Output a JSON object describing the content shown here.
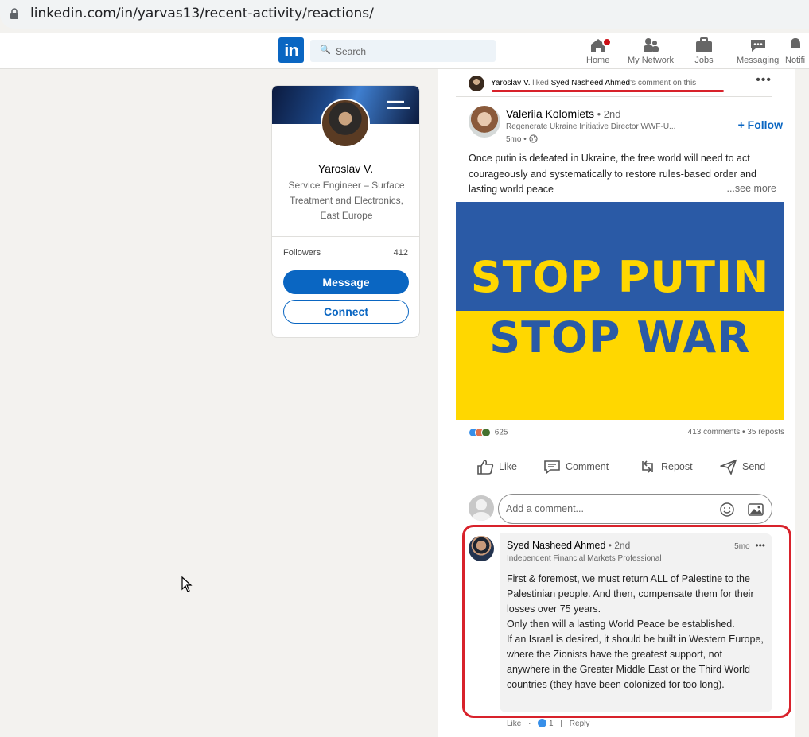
{
  "browser": {
    "url": "linkedin.com/in/yarvas13/recent-activity/reactions/"
  },
  "nav": {
    "logo": "in",
    "search_placeholder": "Search",
    "items": [
      {
        "label": "Home",
        "icon": "home-icon"
      },
      {
        "label": "My Network",
        "icon": "network-icon"
      },
      {
        "label": "Jobs",
        "icon": "briefcase-icon"
      },
      {
        "label": "Messaging",
        "icon": "messaging-icon"
      },
      {
        "label": "Notifi",
        "icon": "bell-icon"
      }
    ]
  },
  "profile": {
    "name": "Yaroslav V.",
    "title": "Service Engineer – Surface Treatment and Electronics, East Europe",
    "followers_label": "Followers",
    "followers_count": "412",
    "message_label": "Message",
    "connect_label": "Connect"
  },
  "activity": {
    "actor": "Yaroslav V.",
    "verb": " liked ",
    "target": "Syed Nasheed Ahmed",
    "suffix": "'s comment on this"
  },
  "post": {
    "author": "Valeriia Kolomiets",
    "degree": " • 2nd",
    "headline": "Regenerate Ukraine Initiative Director WWF-U...",
    "time": "5mo •",
    "follow_label": "+ Follow",
    "text": "Once putin is defeated in Ukraine, the free world will need to act courageously and systematically to restore rules-based order and lasting world peace",
    "see_more": "...see more",
    "image_line1": "STOP PUTIN",
    "image_line2": "STOP WAR",
    "reaction_count": "625",
    "stats": "413 comments • 35 reposts",
    "actions": {
      "like": "Like",
      "comment": "Comment",
      "repost": "Repost",
      "send": "Send"
    },
    "comment_placeholder": "Add a comment..."
  },
  "comment": {
    "author": "Syed Nasheed Ahmed",
    "degree": " • 2nd",
    "headline": "Independent Financial Markets Professional",
    "time": "5mo",
    "text": "First & foremost, we must return ALL of Palestine to the Palestinian people. And then, compensate them for their losses over 75 years.\nOnly then will a lasting World Peace be established.\nIf an Israel is desired, it should be built in Western Europe, where the Zionists have the greatest support, not anywhere in the Greater Middle East or the Third World countries (they have been colonized for too long).",
    "like_label": "Like",
    "like_count": "1",
    "reply_label": "Reply"
  },
  "colors": {
    "brand": "#0a66c2",
    "highlight": "#d8222b",
    "flag_blue": "#2a5aa6",
    "flag_yellow": "#ffd700"
  }
}
